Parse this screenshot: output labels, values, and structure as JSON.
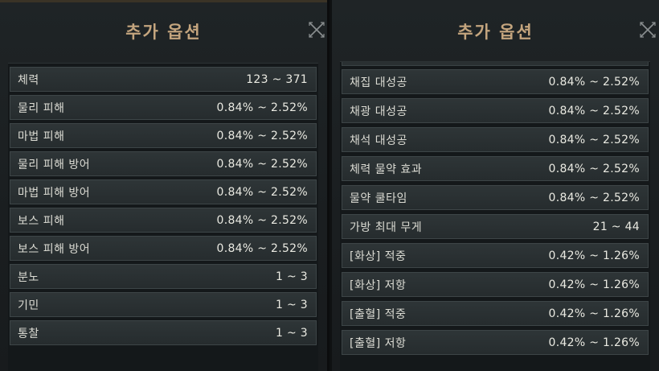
{
  "left_panel": {
    "title": "추가 옵션",
    "rows": [
      {
        "label": "체력",
        "value": "123 ~ 371"
      },
      {
        "label": "물리 피해",
        "value": "0.84% ~ 2.52%"
      },
      {
        "label": "마법 피해",
        "value": "0.84% ~ 2.52%"
      },
      {
        "label": "물리 피해 방어",
        "value": "0.84% ~ 2.52%"
      },
      {
        "label": "마법 피해 방어",
        "value": "0.84% ~ 2.52%"
      },
      {
        "label": "보스 피해",
        "value": "0.84% ~ 2.52%"
      },
      {
        "label": "보스 피해 방어",
        "value": "0.84% ~ 2.52%"
      },
      {
        "label": "분노",
        "value": "1 ~ 3"
      },
      {
        "label": "기민",
        "value": "1 ~ 3"
      },
      {
        "label": "통찰",
        "value": "1 ~ 3"
      }
    ]
  },
  "right_panel": {
    "title": "추가 옵션",
    "rows": [
      {
        "label": "채집 대성공",
        "value": "0.84% ~ 2.52%"
      },
      {
        "label": "채광 대성공",
        "value": "0.84% ~ 2.52%"
      },
      {
        "label": "채석 대성공",
        "value": "0.84% ~ 2.52%"
      },
      {
        "label": "체력 물약 효과",
        "value": "0.84% ~ 2.52%"
      },
      {
        "label": "물약 쿨타임",
        "value": "0.84% ~ 2.52%"
      },
      {
        "label": "가방 최대 무게",
        "value": "21 ~ 44"
      },
      {
        "label": "[화상] 적중",
        "value": "0.42% ~ 1.26%"
      },
      {
        "label": "[화상] 저항",
        "value": "0.42% ~ 1.26%"
      },
      {
        "label": "[출혈] 적중",
        "value": "0.42% ~ 1.26%"
      },
      {
        "label": "[출혈] 저항",
        "value": "0.42% ~ 1.26%"
      }
    ]
  },
  "icons": {
    "close": "close-x-icon"
  },
  "colors": {
    "title": "#c4a57e",
    "row_bg": "#2b3234",
    "text": "#dcdcd4"
  }
}
